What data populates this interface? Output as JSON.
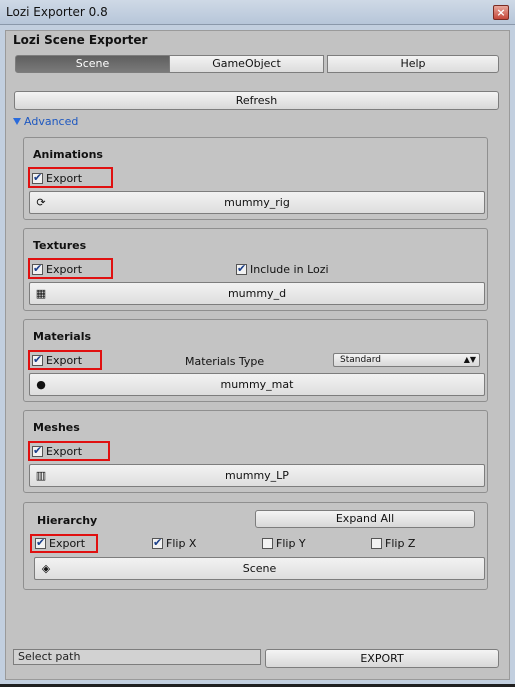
{
  "window": {
    "title": "Lozi Exporter 0.8",
    "close_glyph": "×"
  },
  "header": {
    "title": "Lozi Scene Exporter"
  },
  "tabs": [
    {
      "label": "Scene",
      "active": true
    },
    {
      "label": "GameObject",
      "active": false
    },
    {
      "label": "Help",
      "active": false
    }
  ],
  "refresh_label": "Refresh",
  "advanced_label": "Advanced",
  "animations": {
    "title": "Animations",
    "export_label": "Export",
    "export_checked": true,
    "object_name": "mummy_rig",
    "icon": "rig-icon"
  },
  "textures": {
    "title": "Textures",
    "export_label": "Export",
    "export_checked": true,
    "include_label": "Include in Lozi",
    "include_checked": true,
    "object_name": "mummy_d",
    "icon": "texture-icon"
  },
  "materials": {
    "title": "Materials",
    "export_label": "Export",
    "export_checked": true,
    "type_label": "Materials Type",
    "type_value": "Standard",
    "object_name": "mummy_mat",
    "icon": "material-sphere-icon"
  },
  "meshes": {
    "title": "Meshes",
    "export_label": "Export",
    "export_checked": true,
    "object_name": "mummy_LP",
    "icon": "mesh-icon"
  },
  "hierarchy": {
    "title": "Hierarchy",
    "expand_label": "Expand All",
    "export_label": "Export",
    "export_checked": true,
    "flip_x_label": "Flip X",
    "flip_x_checked": true,
    "flip_y_label": "Flip Y",
    "flip_y_checked": false,
    "flip_z_label": "Flip Z",
    "flip_z_checked": false,
    "object_name": "Scene",
    "icon": "unity-scene-icon"
  },
  "footer": {
    "path_placeholder": "Select path",
    "export_label": "EXPORT"
  },
  "colors": {
    "highlight": "#e01010",
    "link": "#1e58c0",
    "active_tab": "#6a6a6a"
  }
}
